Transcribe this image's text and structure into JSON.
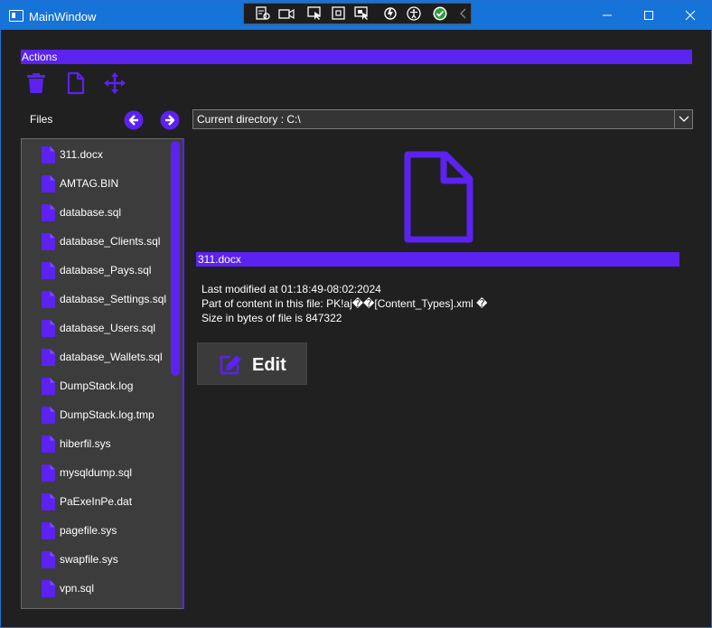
{
  "window": {
    "title": "MainWindow",
    "accent": "#5b22f0",
    "titlebar_color": "#1673d8"
  },
  "devtools": {
    "icons": [
      "live-visual-tree-icon",
      "record-icon",
      "select-element-icon",
      "layout-adorner-icon",
      "track-focus-icon",
      "hot-reload-icon",
      "accessibility-icon",
      "check-icon",
      "collapse-chevron-icon"
    ]
  },
  "actions": {
    "header": "Actions",
    "tools": [
      "trash-icon",
      "new-file-icon",
      "move-icon"
    ]
  },
  "files_panel": {
    "label": "Files",
    "items": [
      "311.docx",
      "AMTAG.BIN",
      "database.sql",
      "database_Clients.sql",
      "database_Pays.sql",
      "database_Settings.sql",
      "database_Users.sql",
      "database_Wallets.sql",
      "DumpStack.log",
      "DumpStack.log.tmp",
      "hiberfil.sys",
      "mysqldump.sql",
      "PaExeInPe.dat",
      "pagefile.sys",
      "swapfile.sys",
      "vpn.sql"
    ]
  },
  "directory": {
    "value": "Current directory : C:\\"
  },
  "details": {
    "selected_name": "311.docx",
    "last_modified": "Last modified at 01:18:49-08:02:2024",
    "content_preview": "Part of content in this file: PK!aj��[Content_Types].xml �",
    "size": "Size in bytes of file is 847322"
  },
  "edit_button": {
    "label": "Edit"
  }
}
